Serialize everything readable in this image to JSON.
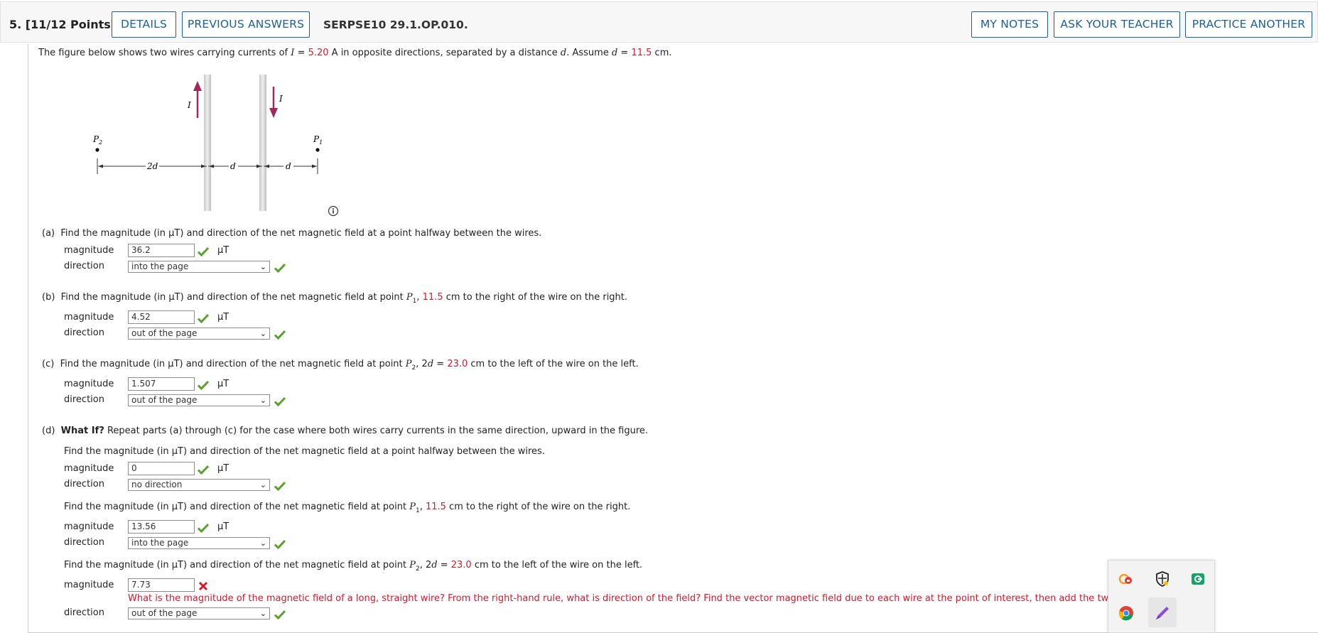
{
  "header": {
    "question": "5.  [11/12 Points]",
    "details": "DETAILS",
    "previous": "PREVIOUS ANSWERS",
    "code": "SERPSE10 29.1.OP.010.",
    "notes": "MY NOTES",
    "ask": "ASK YOUR TEACHER",
    "practice": "PRACTICE ANOTHER"
  },
  "intro": {
    "pre": "The figure below shows two wires carrying currents of ",
    "I": "I",
    "eq": " = ",
    "current": "5.20",
    "mid": " A in opposite directions, separated by a distance ",
    "d": "d",
    "assume": ". Assume ",
    "d2": "d",
    "eq2": " = ",
    "dval": "11.5",
    "unit": " cm."
  },
  "figure": {
    "P2": "P",
    "P2sub": "2",
    "P1": "P",
    "P1sub": "1",
    "I_left": "I",
    "I_right": "I",
    "dim_2d": "2d",
    "dim_d1": "d",
    "dim_d2": "d"
  },
  "labels": {
    "magnitude": "magnitude",
    "direction": "direction",
    "unit": "μT"
  },
  "a": {
    "tag": "(a)",
    "q": "Find the magnitude (in μT) and direction of the net magnetic field at a point halfway between the wires.",
    "mag": "36.2",
    "dir": "into the page"
  },
  "b": {
    "tag": "(b)",
    "q1": "Find the magnitude (in μT) and direction of the net magnetic field at point ",
    "p": "P",
    "psub": "1",
    "q2": ", ",
    "val": "11.5",
    "q3": " cm to the right of the wire on the right.",
    "mag": "4.52",
    "dir": "out of the page"
  },
  "c": {
    "tag": "(c)",
    "q1": "Find the magnitude (in μT) and direction of the net magnetic field at point ",
    "p": "P",
    "psub": "2",
    "q2": ", 2",
    "dvar": "d",
    "eq": " = ",
    "val": "23.0",
    "q3": " cm to the left of the wire on the left.",
    "mag": "1.507",
    "dir": "out of the page"
  },
  "d": {
    "tag": "(d)",
    "whatif": "What If?",
    "rest": " Repeat parts (a) through (c) for the case where both wires carry currents in the same direction, upward in the figure.",
    "q_mid": "Find the magnitude (in μT) and direction of the net magnetic field at a point halfway between the wires.",
    "mag1": "0",
    "dir1": "no direction",
    "q2_1": "Find the magnitude (in μT) and direction of the net magnetic field at point ",
    "p1": "P",
    "p1sub": "1",
    "q2_2": ", ",
    "val2": "11.5",
    "q2_3": " cm to the right of the wire on the right.",
    "mag2": "13.56",
    "dir2": "into the page",
    "q3_1": "Find the magnitude (in μT) and direction of the net magnetic field at point ",
    "p2": "P",
    "p2sub": "2",
    "q3_2": ", 2",
    "dvar": "d",
    "eq": " = ",
    "val3": "23.0",
    "q3_3": " cm to the left of the wire on the left.",
    "mag3": "7.73",
    "dir3": "out of the page",
    "hint": "What is the magnitude of the magnetic field of a long, straight wire? From the right-hand rule, what is direction of the field? Find the vector magnetic field due to each wire at the point of interest, then add the two as vectors."
  },
  "colors": {
    "accent": "#1b5e98",
    "value": "#d6182b",
    "check": "#5aa02c",
    "current_arrow": "#9e2a5c"
  }
}
